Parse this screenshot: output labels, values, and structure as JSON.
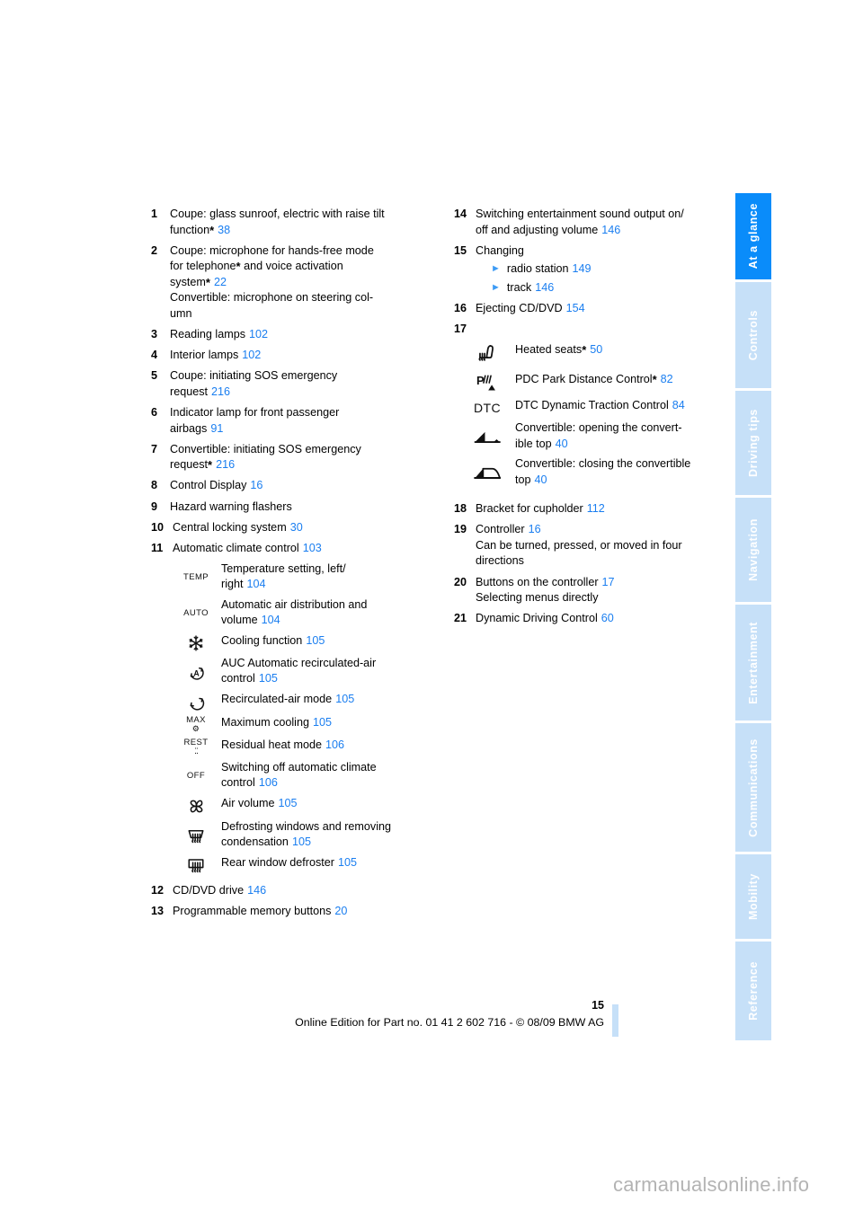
{
  "page": {
    "number": "15",
    "footer": "Online Edition for Part no. 01 41 2 602 716 - © 08/09 BMW AG",
    "watermark": "carmanualsonline.info",
    "accent_blue": "#1a7ef0",
    "tab_active_blue": "#0a8cfa",
    "tab_inactive_blue": "#c6e0f8"
  },
  "sidebar": {
    "items": [
      {
        "label": "At a glance",
        "active": true
      },
      {
        "label": "Controls",
        "active": false
      },
      {
        "label": "Driving tips",
        "active": false
      },
      {
        "label": "Navigation",
        "active": false
      },
      {
        "label": "Entertainment",
        "active": false
      },
      {
        "label": "Communications",
        "active": false
      },
      {
        "label": "Mobility",
        "active": false
      },
      {
        "label": "Reference",
        "active": false
      }
    ]
  },
  "left_column": {
    "items": [
      {
        "num": "1",
        "lines": [
          {
            "text": "Coupe: glass sunroof, electric with raise tilt"
          },
          {
            "text": "function",
            "star": true,
            "ref": "38"
          }
        ]
      },
      {
        "num": "2",
        "lines": [
          {
            "text": "Coupe: microphone for hands-free mode"
          },
          {
            "text": "for telephone",
            "star": true,
            "after": " and voice activation"
          },
          {
            "text": "system",
            "star": true,
            "ref": "22"
          },
          {
            "text": "Convertible: microphone on steering col-"
          },
          {
            "text": "umn"
          }
        ]
      },
      {
        "num": "3",
        "lines": [
          {
            "text": "Reading lamps",
            "ref": "102"
          }
        ]
      },
      {
        "num": "4",
        "lines": [
          {
            "text": "Interior lamps",
            "ref": "102"
          }
        ]
      },
      {
        "num": "5",
        "lines": [
          {
            "text": "Coupe: initiating SOS emergency"
          },
          {
            "text": "request",
            "ref": "216"
          }
        ]
      },
      {
        "num": "6",
        "lines": [
          {
            "text": "Indicator lamp for front passenger"
          },
          {
            "text": "airbags",
            "ref": "91"
          }
        ]
      },
      {
        "num": "7",
        "lines": [
          {
            "text": "Convertible: initiating SOS emergency"
          },
          {
            "text": "request",
            "star": true,
            "ref": "216"
          }
        ]
      },
      {
        "num": "8",
        "lines": [
          {
            "text": "Control Display",
            "ref": "16"
          }
        ]
      },
      {
        "num": "9",
        "lines": [
          {
            "text": "Hazard warning flashers"
          }
        ]
      },
      {
        "num": "10",
        "lines": [
          {
            "text": "Central locking system",
            "ref": "30"
          }
        ]
      },
      {
        "num": "11",
        "lines": [
          {
            "text": "Automatic climate control",
            "ref": "103"
          }
        ]
      }
    ],
    "climate_icons": [
      {
        "icon": "temp-icon",
        "icon_text": "TEMP",
        "label_lines": [
          "Temperature setting, left/",
          "right"
        ],
        "ref": "104"
      },
      {
        "icon": "auto-icon",
        "icon_text": "AUTO",
        "label_lines": [
          "Automatic air distribution and",
          "volume"
        ],
        "ref": "104"
      },
      {
        "icon": "snowflake-icon",
        "icon_text": "",
        "label_lines": [
          "Cooling function"
        ],
        "ref": "105"
      },
      {
        "icon": "auc-recirculation-icon",
        "icon_text": "",
        "label_lines": [
          "AUC Automatic recirculated-air",
          "control"
        ],
        "ref": "105"
      },
      {
        "icon": "recirculated-air-icon",
        "icon_text": "",
        "label_lines": [
          "Recirculated-air mode"
        ],
        "ref": "105"
      },
      {
        "icon": "max-cooling-icon",
        "icon_text": "MAX",
        "label_lines": [
          "Maximum cooling"
        ],
        "ref": "105"
      },
      {
        "icon": "residual-heat-icon",
        "icon_text": "REST",
        "label_lines": [
          "Residual heat mode"
        ],
        "ref": "106"
      },
      {
        "icon": "off-icon",
        "icon_text": "OFF",
        "label_lines": [
          "Switching off automatic climate",
          "control"
        ],
        "ref": "106"
      },
      {
        "icon": "fan-icon",
        "icon_text": "",
        "label_lines": [
          "Air volume"
        ],
        "ref": "105"
      },
      {
        "icon": "windshield-defrost-icon",
        "icon_text": "",
        "label_lines": [
          "Defrosting windows and removing",
          "condensation"
        ],
        "ref": "105"
      },
      {
        "icon": "rear-defrost-icon",
        "icon_text": "",
        "label_lines": [
          "Rear window defroster"
        ],
        "ref": "105"
      }
    ],
    "items_tail": [
      {
        "num": "12",
        "lines": [
          {
            "text": "CD/DVD drive",
            "ref": "146"
          }
        ]
      },
      {
        "num": "13",
        "lines": [
          {
            "text": "Programmable memory buttons",
            "ref": "20"
          }
        ]
      }
    ]
  },
  "right_column": {
    "items": [
      {
        "num": "14",
        "lines": [
          {
            "text": "Switching entertainment sound output on/"
          },
          {
            "text": "off and adjusting volume",
            "ref": "146"
          }
        ]
      },
      {
        "num": "15",
        "lines": [
          {
            "text": "Changing"
          }
        ],
        "subitems": [
          {
            "text": "radio station",
            "ref": "149"
          },
          {
            "text": "track",
            "ref": "146"
          }
        ]
      },
      {
        "num": "16",
        "lines": [
          {
            "text": "Ejecting CD/DVD",
            "ref": "154"
          }
        ]
      },
      {
        "num": "17",
        "lines": []
      }
    ],
    "control_icons": [
      {
        "icon": "heated-seats-icon",
        "label_lines": [
          "Heated seats"
        ],
        "star": true,
        "ref": "50"
      },
      {
        "icon": "pdc-icon",
        "label_lines": [
          "PDC Park Distance Control"
        ],
        "star": true,
        "ref": "82"
      },
      {
        "icon": "dtc-icon",
        "icon_text": "DTC",
        "label_lines": [
          "DTC Dynamic Traction Control"
        ],
        "star": false,
        "ref": "84"
      },
      {
        "icon": "convertible-open-icon",
        "label_lines": [
          "Convertible: opening the convert-",
          "ible top"
        ],
        "star": false,
        "ref": "40"
      },
      {
        "icon": "convertible-close-icon",
        "label_lines": [
          "Convertible: closing the convertible",
          "top"
        ],
        "star": false,
        "ref": "40"
      }
    ],
    "items_tail": [
      {
        "num": "18",
        "lines": [
          {
            "text": "Bracket for cupholder",
            "ref": "112"
          }
        ]
      },
      {
        "num": "19",
        "lines": [
          {
            "text": "Controller",
            "ref": "16"
          },
          {
            "text": "Can be turned, pressed, or moved in four"
          },
          {
            "text": "directions"
          }
        ]
      },
      {
        "num": "20",
        "lines": [
          {
            "text": "Buttons on the controller",
            "ref": "17"
          },
          {
            "text": "Selecting menus directly"
          }
        ]
      },
      {
        "num": "21",
        "lines": [
          {
            "text": "Dynamic Driving Control",
            "ref": "60"
          }
        ]
      }
    ]
  }
}
